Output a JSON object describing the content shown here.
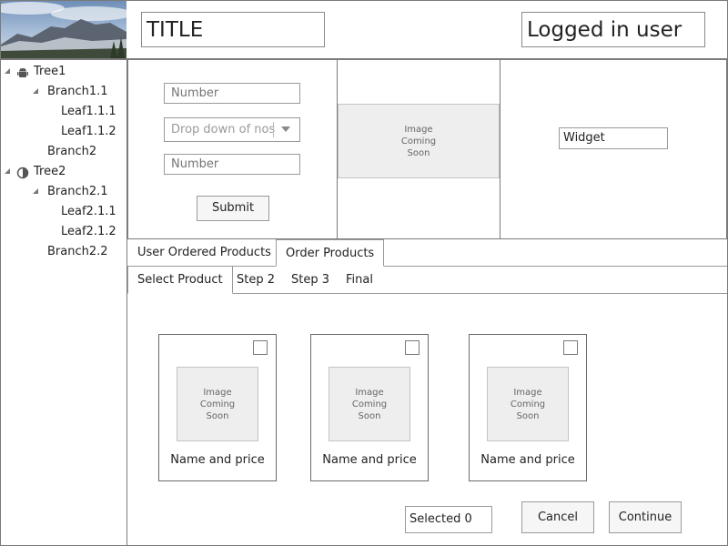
{
  "header": {
    "title": "TITLE",
    "user": "Logged in user"
  },
  "tree": {
    "items": [
      {
        "label": "Tree1",
        "icon": "android-icon",
        "expanded": true
      },
      {
        "label": "Branch1.1",
        "expanded": true
      },
      {
        "label": "Leaf1.1.1"
      },
      {
        "label": "Leaf1.1.2"
      },
      {
        "label": "Branch2"
      },
      {
        "label": "Tree2",
        "icon": "half-circle-icon",
        "expanded": true
      },
      {
        "label": "Branch2.1",
        "expanded": true
      },
      {
        "label": "Leaf2.1.1"
      },
      {
        "label": "Leaf2.1.2"
      },
      {
        "label": "Branch2.2"
      }
    ]
  },
  "form": {
    "number1_placeholder": "Number",
    "dropdown_placeholder": "Drop down of nos",
    "number2_placeholder": "Number",
    "submit_label": "Submit"
  },
  "image_placeholder": {
    "line1": "Image",
    "line2": "Coming",
    "line3": "Soon"
  },
  "widget": {
    "value": "Widget"
  },
  "tabs": {
    "main": [
      {
        "label": "User Ordered Products",
        "active": false
      },
      {
        "label": "Order Products",
        "active": true
      }
    ],
    "steps": [
      {
        "label": "Select Product",
        "active": true
      },
      {
        "label": "Step 2",
        "active": false
      },
      {
        "label": "Step 3",
        "active": false
      },
      {
        "label": "Final",
        "active": false
      }
    ]
  },
  "products": [
    {
      "name": "Name and price"
    },
    {
      "name": "Name and price"
    },
    {
      "name": "Name and price"
    }
  ],
  "footer": {
    "selected": "Selected 0",
    "cancel_label": "Cancel",
    "continue_label": "Continue"
  }
}
